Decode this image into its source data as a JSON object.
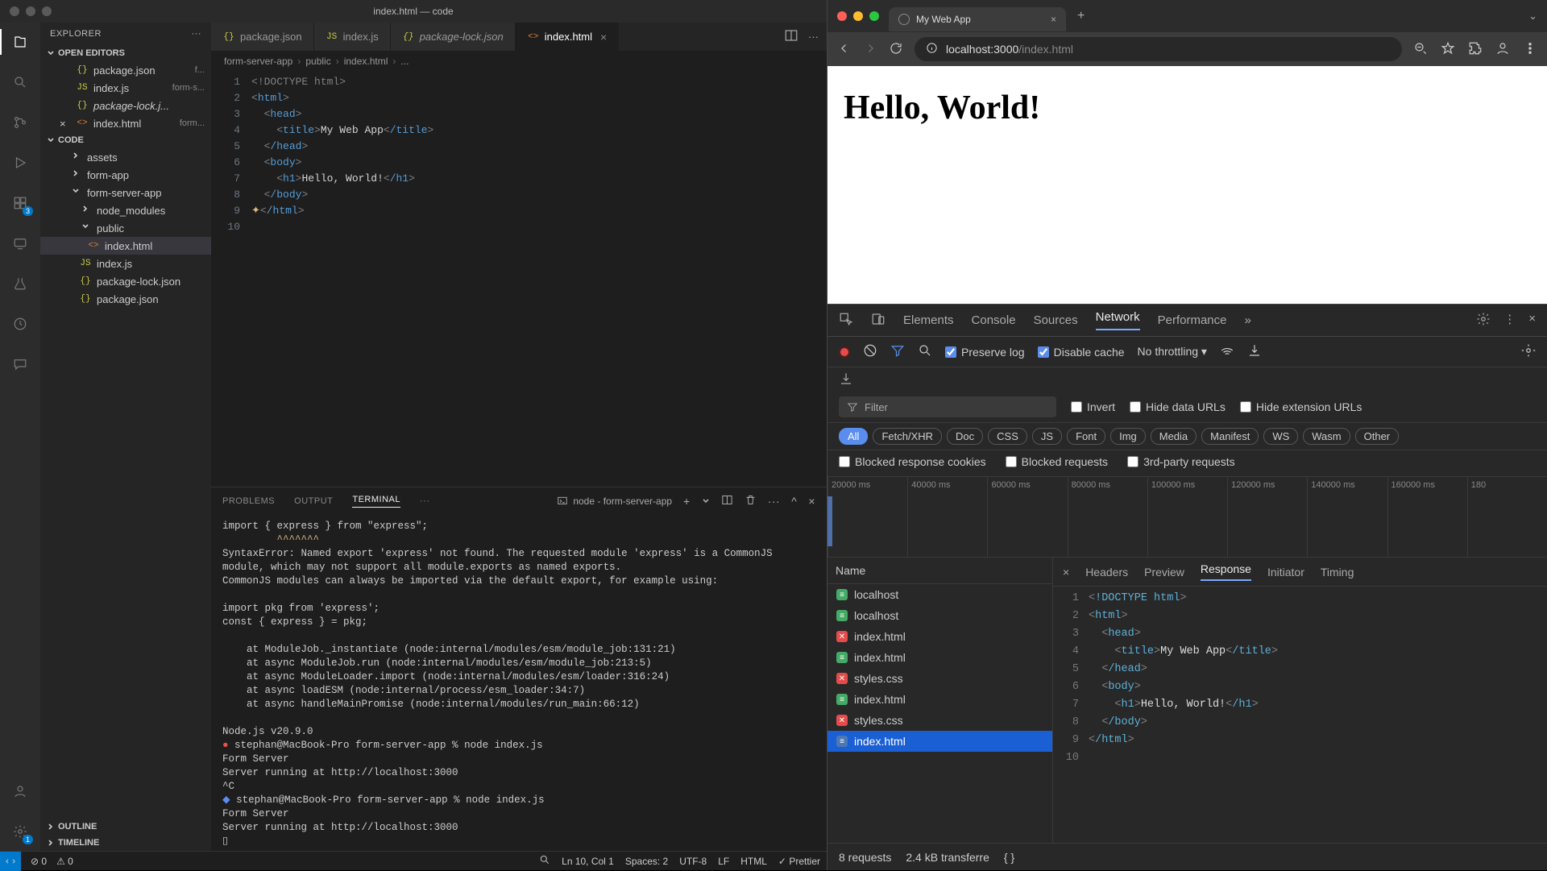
{
  "vscode": {
    "title": "index.html — code",
    "explorer_label": "EXPLORER",
    "open_editors_label": "OPEN EDITORS",
    "open_editors": [
      {
        "name": "package.json",
        "meta": "f..."
      },
      {
        "name": "index.js",
        "meta": "form-s..."
      },
      {
        "name": "package-lock.j...",
        "meta": "",
        "italic": true
      },
      {
        "name": "index.html",
        "meta": "form...",
        "close": true
      }
    ],
    "project_label": "CODE",
    "tree": [
      {
        "lv": 2,
        "kind": "folder",
        "name": "assets"
      },
      {
        "lv": 2,
        "kind": "folder",
        "name": "form-app"
      },
      {
        "lv": 2,
        "kind": "folder-open",
        "name": "form-server-app"
      },
      {
        "lv": 3,
        "kind": "folder",
        "name": "node_modules"
      },
      {
        "lv": 3,
        "kind": "folder-open",
        "name": "public"
      },
      {
        "lv": 4,
        "kind": "html",
        "name": "index.html",
        "sel": true
      },
      {
        "lv": 3,
        "kind": "js",
        "name": "index.js"
      },
      {
        "lv": 3,
        "kind": "json",
        "name": "package-lock.json"
      },
      {
        "lv": 3,
        "kind": "json",
        "name": "package.json"
      }
    ],
    "outline_label": "OUTLINE",
    "timeline_label": "TIMELINE",
    "tabs": [
      {
        "icon": "json",
        "label": "package.json"
      },
      {
        "icon": "js",
        "label": "index.js"
      },
      {
        "icon": "json",
        "label": "package-lock.json",
        "italic": true
      },
      {
        "icon": "html",
        "label": "index.html",
        "active": true,
        "close": true
      }
    ],
    "breadcrumb": [
      "form-server-app",
      "public",
      "index.html",
      "..."
    ],
    "code_lines": [
      "<!DOCTYPE html>",
      "<html>",
      "  <head>",
      "    <title>My Web App</title>",
      "  </head>",
      "  <body>",
      "    <h1>Hello, World!</h1>",
      "  </body>",
      "</html>",
      ""
    ],
    "panel": {
      "tabs": [
        "PROBLEMS",
        "OUTPUT",
        "TERMINAL",
        "···"
      ],
      "active_tab": "TERMINAL",
      "select_label": "node - form-server-app",
      "lines": [
        "import { express } from \"express\";",
        "         ^^^^^^^",
        "SyntaxError: Named export 'express' not found. The requested module 'express' is a CommonJS module, which may not support all module.exports as named exports.",
        "CommonJS modules can always be imported via the default export, for example using:",
        "",
        "import pkg from 'express';",
        "const { express } = pkg;",
        "",
        "    at ModuleJob._instantiate (node:internal/modules/esm/module_job:131:21)",
        "    at async ModuleJob.run (node:internal/modules/esm/module_job:213:5)",
        "    at async ModuleLoader.import (node:internal/modules/esm/loader:316:24)",
        "    at async loadESM (node:internal/process/esm_loader:34:7)",
        "    at async handleMainPromise (node:internal/modules/run_main:66:12)",
        "",
        "Node.js v20.9.0",
        "● stephan@MacBook-Pro form-server-app % node index.js",
        "Form Server",
        "Server running at http://localhost:3000",
        "^C",
        "◆ stephan@MacBook-Pro form-server-app % node index.js",
        "Form Server",
        "Server running at http://localhost:3000",
        "▯"
      ]
    },
    "status": {
      "errors": "0",
      "warnings": "0",
      "cursor": "Ln 10, Col 1",
      "spaces": "Spaces: 2",
      "encoding": "UTF-8",
      "eol": "LF",
      "lang": "HTML",
      "prettier": "Prettier"
    }
  },
  "browser": {
    "tab_title": "My Web App",
    "url_host": "localhost:3000",
    "url_path": "/index.html",
    "page_heading": "Hello, World!"
  },
  "devtools": {
    "tabs": [
      "Elements",
      "Console",
      "Sources",
      "Network",
      "Performance"
    ],
    "active_tab": "Network",
    "preserve_log": "Preserve log",
    "disable_cache": "Disable cache",
    "throttling": "No throttling",
    "filter_placeholder": "Filter",
    "invert": "Invert",
    "hide_data_urls": "Hide data URLs",
    "hide_ext_urls": "Hide extension URLs",
    "type_filters": [
      "All",
      "Fetch/XHR",
      "Doc",
      "CSS",
      "JS",
      "Font",
      "Img",
      "Media",
      "Manifest",
      "WS",
      "Wasm",
      "Other"
    ],
    "blocked_cookies": "Blocked response cookies",
    "blocked_requests": "Blocked requests",
    "third_party": "3rd-party requests",
    "timeline_ticks": [
      "20000 ms",
      "40000 ms",
      "60000 ms",
      "80000 ms",
      "100000 ms",
      "120000 ms",
      "140000 ms",
      "160000 ms",
      "180"
    ],
    "name_header": "Name",
    "requests": [
      {
        "status": "doc",
        "name": "localhost"
      },
      {
        "status": "doc",
        "name": "localhost"
      },
      {
        "status": "err",
        "name": "index.html"
      },
      {
        "status": "doc",
        "name": "index.html"
      },
      {
        "status": "err",
        "name": "styles.css"
      },
      {
        "status": "doc",
        "name": "index.html"
      },
      {
        "status": "err",
        "name": "styles.css"
      },
      {
        "status": "ok",
        "name": "index.html",
        "selected": true
      }
    ],
    "res_tabs": [
      "Headers",
      "Preview",
      "Response",
      "Initiator",
      "Timing"
    ],
    "res_active": "Response",
    "res_lines": [
      "<!DOCTYPE html>",
      "<html>",
      "  <head>",
      "    <title>My Web App</title>",
      "  </head>",
      "  <body>",
      "    <h1>Hello, World!</h1>",
      "  </body>",
      "</html>",
      ""
    ],
    "status_requests": "8 requests",
    "status_transferred": "2.4 kB transferre"
  }
}
